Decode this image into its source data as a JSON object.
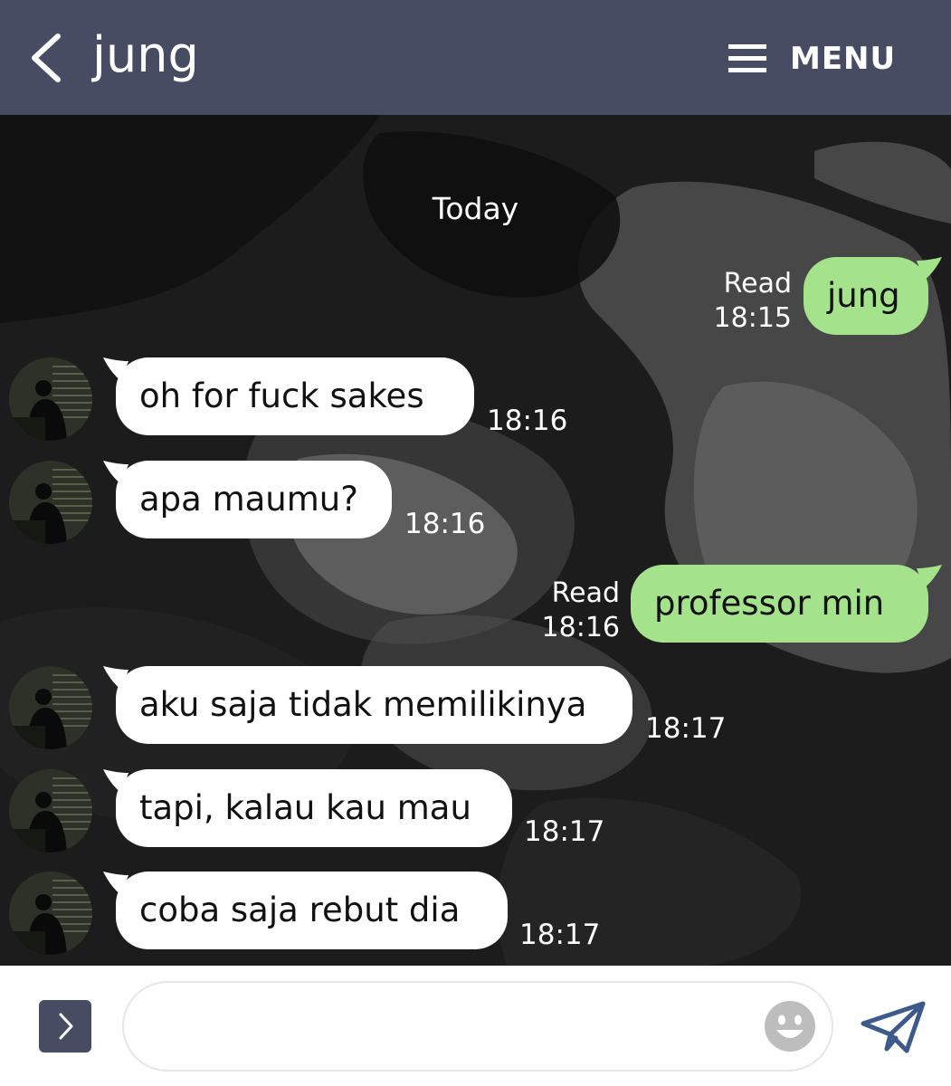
{
  "header": {
    "title": "jung",
    "menu_label": "MENU"
  },
  "chat": {
    "date_label": "Today",
    "messages": [
      {
        "side": "out",
        "text": "jung",
        "read": "Read",
        "time": "18:15"
      },
      {
        "side": "in",
        "text": "oh for fuck sakes",
        "time": "18:16"
      },
      {
        "side": "in",
        "text": "apa maumu?",
        "time": "18:16"
      },
      {
        "side": "out",
        "text": "professor min",
        "read": "Read",
        "time": "18:16"
      },
      {
        "side": "in",
        "text": "aku saja tidak memilikinya",
        "time": "18:17"
      },
      {
        "side": "in",
        "text": "tapi, kalau kau mau",
        "time": "18:17"
      },
      {
        "side": "in",
        "text": "coba saja rebut dia",
        "time": "18:17"
      }
    ]
  },
  "input": {
    "placeholder": ""
  },
  "icons": {
    "back": "chevron-left-icon",
    "menu": "hamburger-icon",
    "expand": "chevron-right-icon",
    "emoji": "smiley-icon",
    "send": "paper-plane-icon"
  },
  "colors": {
    "header_bg": "#474c63",
    "outgoing_bubble": "#a4e38b",
    "incoming_bubble": "#ffffff",
    "send_icon": "#3d5a8a"
  }
}
